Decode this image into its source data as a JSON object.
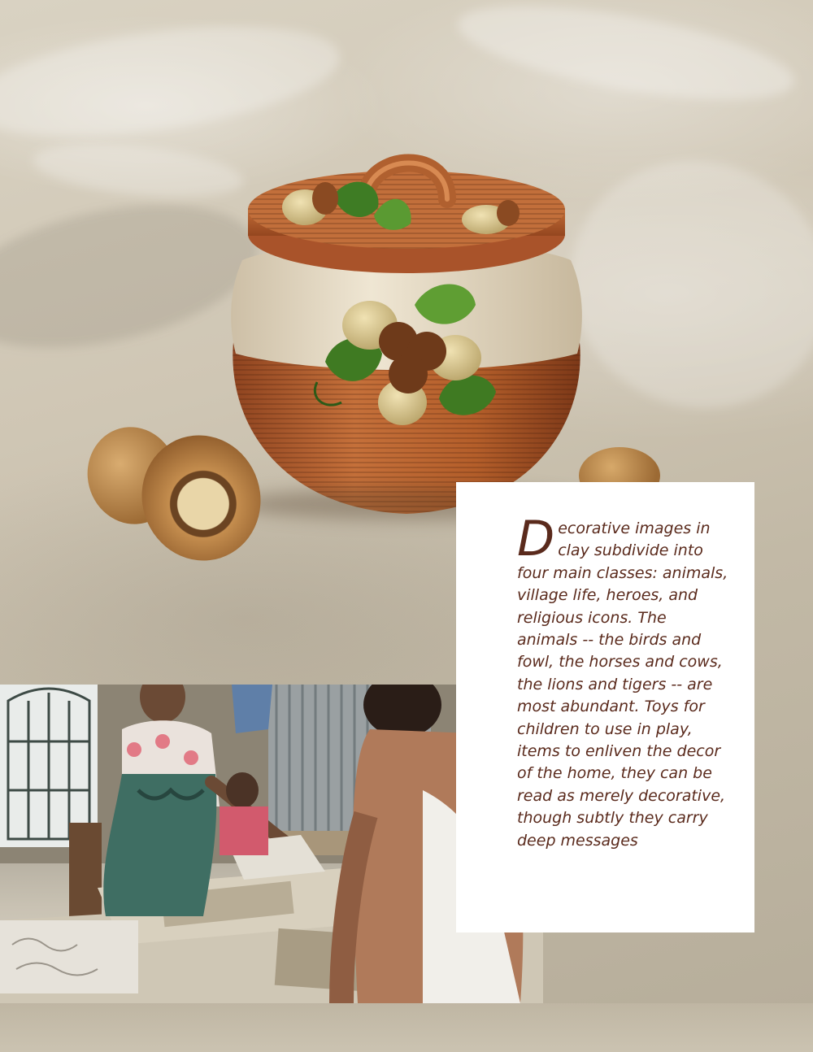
{
  "figure": {
    "pot_photo": "terracotta pot with acorn-and-oak-leaf relief on linen, with walnuts",
    "workshop_photo": "artisans pressing clay tiles at a workshop table"
  },
  "text_card": {
    "dropcap": "D",
    "body": "ecorative images in clay subdivide into four main classes: animals, village life, heroes, and religious icons. The animals -- the birds and fowl, the horses and cows, the lions and tigers -- are most abundant. Toys for children to use in play, items to enliven the decor of the home, they can be read as merely decorative, though subtly they carry deep messages"
  },
  "colors": {
    "text": "#5a2a1c",
    "terracotta": "#b8602c",
    "cream": "#e8dcc6",
    "leaf": "#4f8a2a"
  }
}
